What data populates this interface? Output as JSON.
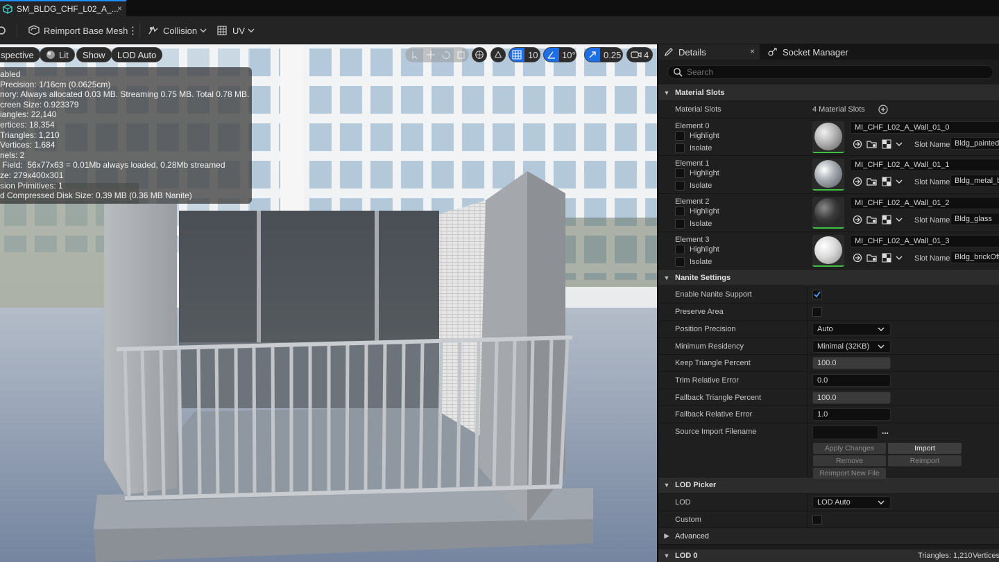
{
  "tab": {
    "title": "SM_BLDG_CHF_L02_A_...",
    "close": "×"
  },
  "toolbar": {
    "reimport_label": "Reimport Base Mesh",
    "collision_label": "Collision",
    "uv_label": "UV"
  },
  "viewport": {
    "perspective_label": "spective",
    "lit_label": "Lit",
    "show_label": "Show",
    "lod_label": "LOD Auto",
    "grid_snap": "10",
    "angle_snap": "10°",
    "scale_snap": "0.25",
    "camera_speed": "4",
    "stats": [
      "abled",
      "Precision: 1/16cm (0.0625cm)",
      "nory: Always allocated 0.03 MB. Streaming 0.75 MB. Total 0.78 MB.",
      "creen Size:  0.923379",
      "iangles:  22,140",
      "ertices:  18,354",
      "Triangles:  1,210",
      "Vertices:  1,684",
      "nels:  2",
      " Field:  56x77x63 = 0.01Mb always loaded, 0.28Mb streamed",
      "ze: 279x400x301",
      "sion Primitives:  1",
      "d Compressed Disk Size: 0.39 MB (0.36 MB Nanite)"
    ]
  },
  "panel": {
    "details_tab": "Details",
    "details_close": "×",
    "socket_tab": "Socket Manager",
    "search_placeholder": "Search",
    "material_slots_section": "Material Slots",
    "material_slots_label": "Material Slots",
    "material_slots_value": "4 Material Slots",
    "highlight_label": "Highlight",
    "isolate_label": "Isolate",
    "slot_name_label": "Slot Name",
    "elements": [
      {
        "name": "Element 0",
        "material": "MI_CHF_L02_A_Wall_01_0",
        "slot": "Bldg_paintedSt"
      },
      {
        "name": "Element 1",
        "material": "MI_CHF_L02_A_Wall_01_1",
        "slot": "Bldg_metal_bru"
      },
      {
        "name": "Element 2",
        "material": "MI_CHF_L02_A_Wall_01_2",
        "slot": "Bldg_glass"
      },
      {
        "name": "Element 3",
        "material": "MI_CHF_L02_A_Wall_01_3",
        "slot": "Bldg_brickOffse"
      }
    ],
    "nanite_section": "Nanite Settings",
    "nanite": {
      "enable_label": "Enable Nanite Support",
      "preserve_label": "Preserve Area",
      "position_label": "Position Precision",
      "position_value": "Auto",
      "residency_label": "Minimum Residency",
      "residency_value": "Minimal (32KB)",
      "keep_label": "Keep Triangle Percent",
      "keep_value": "100.0",
      "trim_label": "Trim Relative Error",
      "trim_value": "0.0",
      "fallback_pct_label": "Fallback Triangle Percent",
      "fallback_pct_value": "100.0",
      "fallback_err_label": "Fallback Relative Error",
      "fallback_err_value": "1.0",
      "source_label": "Source Import Filename",
      "source_value": "",
      "more": "...",
      "apply_btn": "Apply Changes",
      "import_btn": "Import",
      "remove_btn": "Remove",
      "reimport_btn": "Reimport",
      "reimport_new_btn": "Reimport New File"
    },
    "lod_picker_section": "LOD Picker",
    "lod_label": "LOD",
    "lod_value": "LOD Auto",
    "custom_label": "Custom",
    "advanced_section": "Advanced",
    "lod0_section": "LOD 0",
    "lod0_triangles": "Triangles: 1,210",
    "lod0_vertices": "Vertices:"
  },
  "colors": {
    "accent": "#1f8fff",
    "check": "#4a9cff",
    "thumb_bar": "#3fbf3f"
  }
}
